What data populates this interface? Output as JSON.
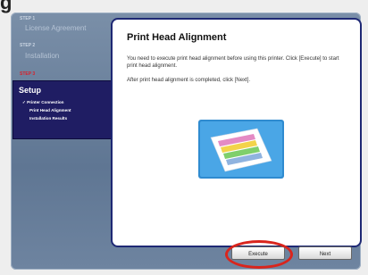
{
  "header": {
    "partial_title": "g"
  },
  "sidebar": {
    "step1_label": "STEP 1",
    "step1_name": "License Agreement",
    "step2_label": "STEP 2",
    "step2_name": "Installation",
    "step3_label": "STEP 3",
    "setup_title": "Setup",
    "setup_items": [
      "✓ Printer Connection",
      "Print Head Alignment",
      "Installation Results"
    ]
  },
  "main": {
    "title": "Print Head Alignment",
    "text1": "You need to execute print head alignment before using this printer. Click [Execute] to start print head alignment.",
    "text2": "After print head alignment is completed, click [Next]."
  },
  "buttons": {
    "execute": "Execute",
    "next": "Next"
  },
  "colors": {
    "highlight": "#d9251d",
    "setup_panel": "#1f1d63",
    "content_border": "#1e2874",
    "active_step": "#d8202a"
  }
}
